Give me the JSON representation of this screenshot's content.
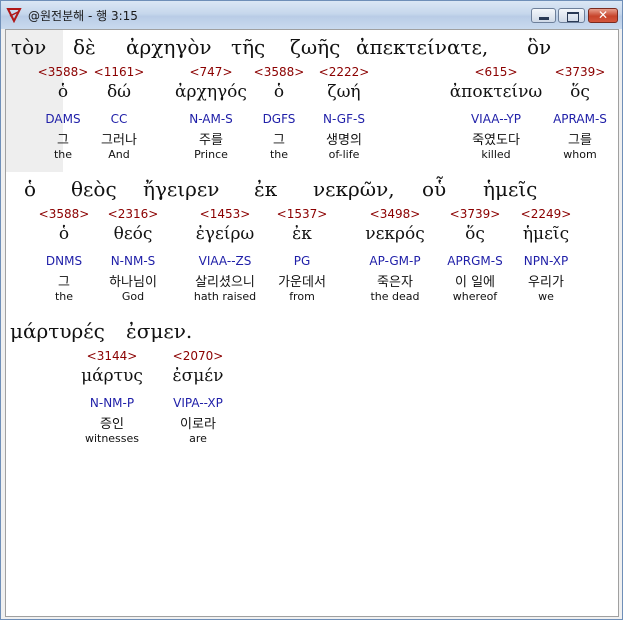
{
  "window": {
    "title": "@원전분해 - 행 3:15"
  },
  "words": [
    {
      "greek": "τὸν",
      "strongs": "<3588>",
      "lexeme": "ὁ",
      "parsing": "DAMS",
      "korean": "그",
      "english": "the"
    },
    {
      "greek": "δὲ",
      "strongs": "<1161>",
      "lexeme": "δώ",
      "parsing": "CC",
      "korean": "그러나",
      "english": "And"
    },
    {
      "greek": "ἀρχηγὸν",
      "strongs": "<747>",
      "lexeme": "ἀρχηγός",
      "parsing": "N-AM-S",
      "korean": "주를",
      "english": "Prince"
    },
    {
      "greek": "τῆς",
      "strongs": "<3588>",
      "lexeme": "ὁ",
      "parsing": "DGFS",
      "korean": "그",
      "english": "the"
    },
    {
      "greek": "ζωῆς",
      "strongs": "<2222>",
      "lexeme": "ζωή",
      "parsing": "N-GF-S",
      "korean": "생명의",
      "english": "of-life"
    },
    {
      "greek": "ἀπεκτείνατε,",
      "strongs": "<615>",
      "lexeme": "ἀποκτείνω",
      "parsing": "VIAA--YP",
      "korean": "죽였도다",
      "english": "killed"
    },
    {
      "greek": "ὃν",
      "strongs": "<3739>",
      "lexeme": "ὅς",
      "parsing": "APRAM-S",
      "korean": "그를",
      "english": "whom"
    },
    {
      "greek": "ὁ",
      "strongs": "<3588>",
      "lexeme": "ὁ",
      "parsing": "DNMS",
      "korean": "그",
      "english": "the"
    },
    {
      "greek": "θεὸς",
      "strongs": "<2316>",
      "lexeme": "θεός",
      "parsing": "N-NM-S",
      "korean": "하나님이",
      "english": "God"
    },
    {
      "greek": "ἤγειρεν",
      "strongs": "<1453>",
      "lexeme": "ἐγείρω",
      "parsing": "VIAA--ZS",
      "korean": "살리셨으니",
      "english": "hath raised"
    },
    {
      "greek": "ἐκ",
      "strongs": "<1537>",
      "lexeme": "ἐκ",
      "parsing": "PG",
      "korean": "가운데서",
      "english": "from"
    },
    {
      "greek": "νεκρῶν,",
      "strongs": "<3498>",
      "lexeme": "νεκρός",
      "parsing": "AP-GM-P",
      "korean": "죽은자",
      "english": "the dead"
    },
    {
      "greek": "οὗ",
      "strongs": "<3739>",
      "lexeme": "ὅς",
      "parsing": "APRGM-S",
      "korean": "이 일에",
      "english": "whereof"
    },
    {
      "greek": "ἡμεῖς",
      "strongs": "<2249>",
      "lexeme": "ἡμεῖς",
      "parsing": "NPN-XP",
      "korean": "우리가",
      "english": "we"
    },
    {
      "greek": "μάρτυρές",
      "strongs": "<3144>",
      "lexeme": "μάρτυς",
      "parsing": "N-NM-P",
      "korean": "증인",
      "english": "witnesses"
    },
    {
      "greek": "ἐσμεν.",
      "strongs": "<2070>",
      "lexeme": "ἐσμέν",
      "parsing": "VIPA--XP",
      "korean": "이로라",
      "english": "are"
    }
  ]
}
